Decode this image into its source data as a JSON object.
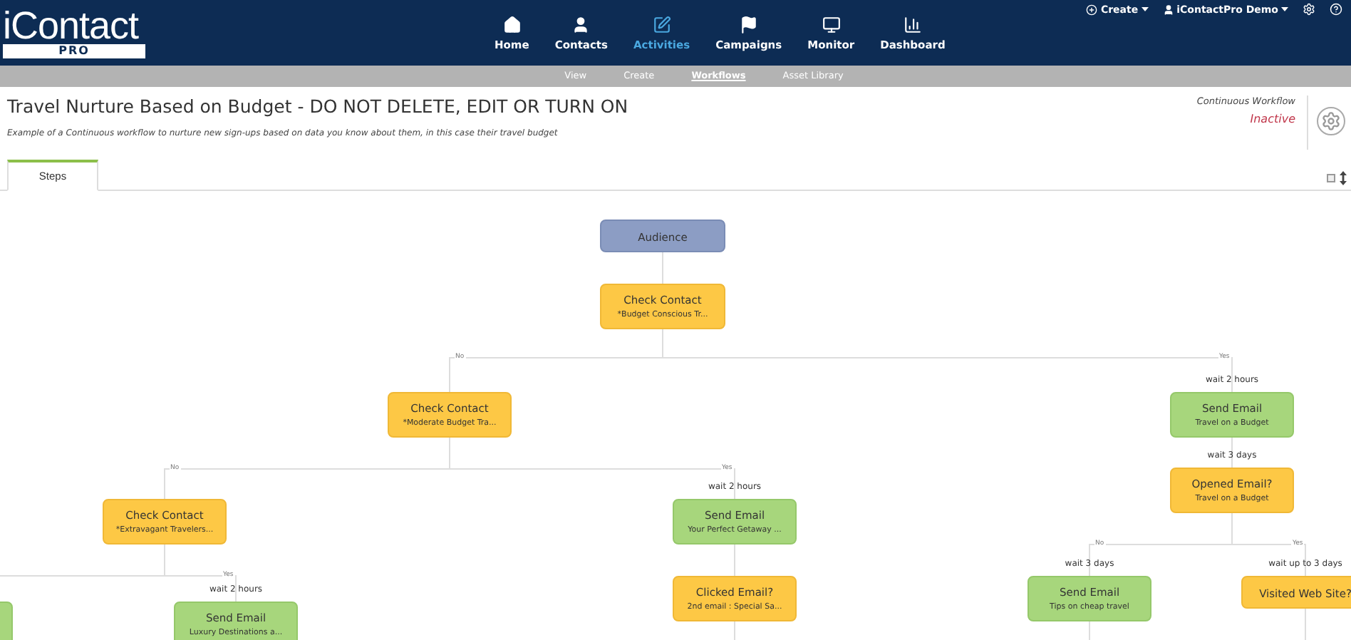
{
  "header": {
    "logo": "iContact",
    "logo_badge": "PRO",
    "nav": [
      {
        "label": "Home",
        "selected": false
      },
      {
        "label": "Contacts",
        "selected": false
      },
      {
        "label": "Activities",
        "selected": true
      },
      {
        "label": "Campaigns",
        "selected": false
      },
      {
        "label": "Monitor",
        "selected": false
      },
      {
        "label": "Dashboard",
        "selected": false
      }
    ],
    "create": "Create",
    "account": "iContactPro Demo"
  },
  "subnav": [
    {
      "label": "View",
      "selected": false
    },
    {
      "label": "Create",
      "selected": false
    },
    {
      "label": "Workflows",
      "selected": true
    },
    {
      "label": "Asset Library",
      "selected": false
    }
  ],
  "workflow": {
    "title": "Travel Nurture Based on Budget - DO NOT DELETE, EDIT OR TURN ON",
    "description": "Example of a Continuous workflow to nurture new sign-ups based on data you know about them, in this case their travel budget",
    "type": "Continuous Workflow",
    "status": "Inactive"
  },
  "tabs": [
    {
      "label": "Steps",
      "selected": true
    }
  ],
  "diagram": {
    "nodes": [
      {
        "kind": "audience",
        "title": "Audience"
      },
      {
        "kind": "condition",
        "title": "Check Contact",
        "subtitle": "*Budget Conscious Tr..."
      },
      {
        "kind": "condition",
        "title": "Check Contact",
        "subtitle": "*Moderate Budget Tra...",
        "branch": "No"
      },
      {
        "kind": "action",
        "title": "Send Email",
        "subtitle": "Travel on a Budget",
        "branch": "Yes",
        "wait": "wait 2 hours"
      },
      {
        "kind": "condition",
        "title": "Opened Email?",
        "subtitle": "Travel on a Budget",
        "wait": "wait 3 days"
      },
      {
        "kind": "condition",
        "title": "Check Contact",
        "subtitle": "*Extravagant Travelers...",
        "branch": "No"
      },
      {
        "kind": "action",
        "title": "Send Email",
        "subtitle": "Your Perfect Getaway ...",
        "branch": "Yes",
        "wait": "wait 2 hours"
      },
      {
        "kind": "condition",
        "title": "Clicked Email?",
        "subtitle": "2nd email : Special Sa..."
      },
      {
        "kind": "action",
        "title": "Send Email",
        "subtitle": "Tips on cheap travel",
        "branch": "No",
        "wait": "wait 3 days"
      },
      {
        "kind": "condition",
        "title": "Visited Web Site?",
        "branch": "Yes",
        "wait": "wait up to 3 days"
      },
      {
        "kind": "action",
        "title": "Send Email",
        "subtitle": "Luxury Destinations a...",
        "branch": "Yes",
        "wait": "wait 2 hours"
      },
      {
        "kind": "action"
      }
    ]
  }
}
